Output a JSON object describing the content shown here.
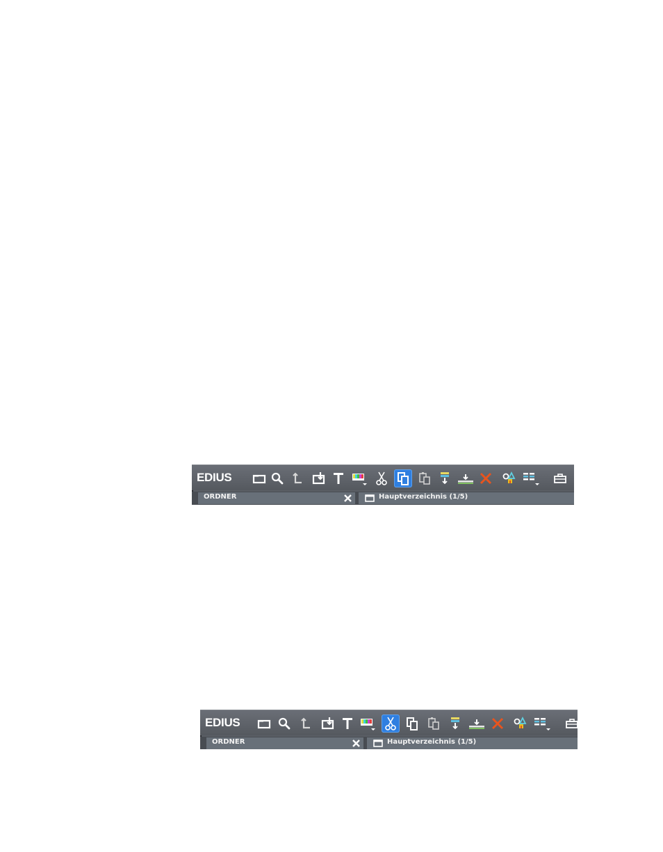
{
  "screens": [
    {
      "app_logo": "EDIUS",
      "active_tool": "copy",
      "folder_tab_label": "ORDNER",
      "bin_path": "Hauptverzeichnis (1/5)"
    },
    {
      "app_logo": "EDIUS",
      "active_tool": "cut",
      "folder_tab_label": "ORDNER",
      "bin_path": "Hauptverzeichnis (1/5)"
    }
  ],
  "toolbar_buttons": [
    {
      "id": "new-folder",
      "icon": "folder-outline-icon"
    },
    {
      "id": "search",
      "icon": "magnifier-icon"
    },
    {
      "id": "up-level",
      "icon": "arrow-up-level-icon"
    },
    {
      "id": "open-clip",
      "icon": "import-box-icon"
    },
    {
      "id": "add-title",
      "icon": "title-t-icon"
    },
    {
      "id": "color-bars",
      "icon": "color-bars-dropdown-icon"
    },
    {
      "id": "cut",
      "icon": "scissors-icon"
    },
    {
      "id": "copy",
      "icon": "copy-icon"
    },
    {
      "id": "paste",
      "icon": "paste-icon"
    },
    {
      "id": "add-to-player",
      "icon": "insert-to-player-icon"
    },
    {
      "id": "add-to-timeline",
      "icon": "add-to-timeline-icon"
    },
    {
      "id": "delete",
      "icon": "delete-x-icon"
    },
    {
      "id": "properties",
      "icon": "properties-shapes-icon"
    },
    {
      "id": "view",
      "icon": "view-grid-dropdown-icon"
    },
    {
      "id": "bin-tools",
      "icon": "toolbox-icon"
    }
  ],
  "colors": {
    "panel_bg": "#5a5e65",
    "tab_bg": "#687079",
    "active_button": "#2f7fe0",
    "delete_icon": "#e8541e",
    "icon_white": "#ffffff"
  }
}
